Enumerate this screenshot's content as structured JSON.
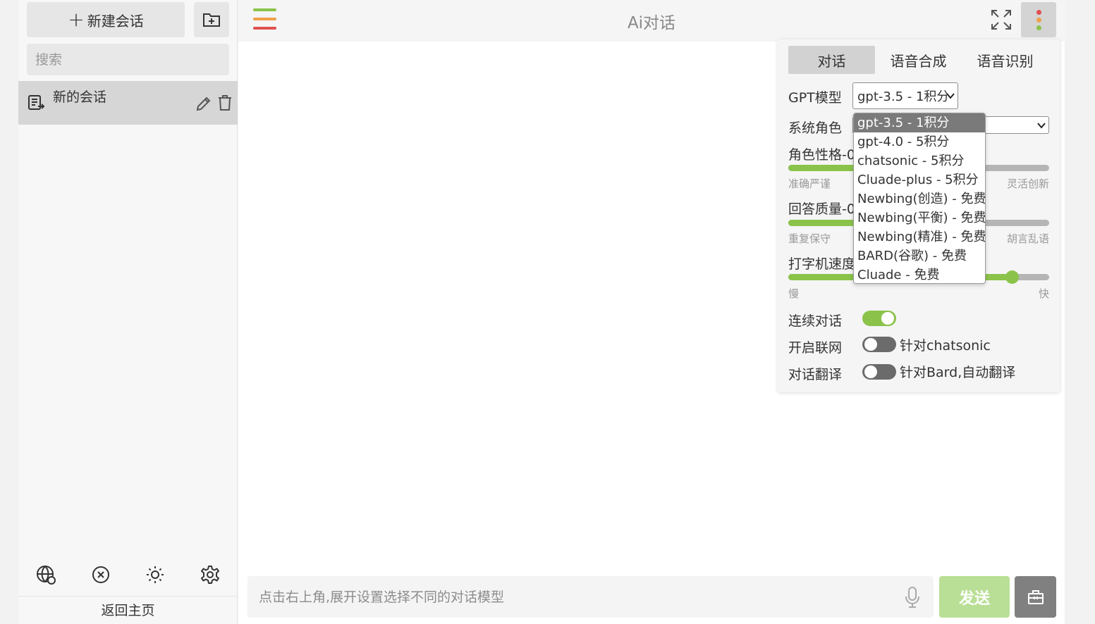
{
  "sidebar": {
    "new_chat_label": "新建会话",
    "search_placeholder": "搜索",
    "conversations": [
      {
        "title": "新的会话"
      }
    ],
    "back_home": "返回主页"
  },
  "header": {
    "title": "Ai对话"
  },
  "settings": {
    "tabs": [
      {
        "label": "对话",
        "active": true
      },
      {
        "label": "语音合成",
        "active": false
      },
      {
        "label": "语音识别",
        "active": false
      }
    ],
    "gpt_model_label": "GPT模型",
    "gpt_model_value": "gpt-3.5 - 1积分",
    "system_role_label": "系统角色",
    "personality_label": "角色性格-0",
    "personality_min": "准确严谨",
    "personality_max": "灵活创新",
    "quality_label": "回答质量-0",
    "quality_min": "重复保守",
    "quality_max": "胡言乱语",
    "typing_label": "打字机速度",
    "typing_min": "慢",
    "typing_max": "快",
    "typing_value": 0.86,
    "continuous_label": "连续对话",
    "continuous_on": true,
    "internet_label": "开启联网",
    "internet_on": false,
    "internet_note": "针对chatsonic",
    "translate_label": "对话翻译",
    "translate_on": false,
    "translate_note": "针对Bard,自动翻译"
  },
  "model_options": [
    "gpt-3.5 - 1积分",
    "gpt-4.0 - 5积分",
    "chatsonic - 5积分",
    "Cluade-plus - 5积分",
    "Newbing(创造) - 免费",
    "Newbing(平衡) - 免费",
    "Newbing(精准) - 免费",
    "BARD(谷歌) - 免费",
    "Cluade - 免费"
  ],
  "input": {
    "placeholder": "点击右上角,展开设置选择不同的对话模型",
    "send_label": "发送"
  },
  "colors": {
    "accent": "#8bc34a",
    "menu_lines": [
      "#8bc34a",
      "#f0a04b",
      "#e05050"
    ],
    "dots": [
      "#e05050",
      "#f0a04b",
      "#8bc34a"
    ]
  }
}
